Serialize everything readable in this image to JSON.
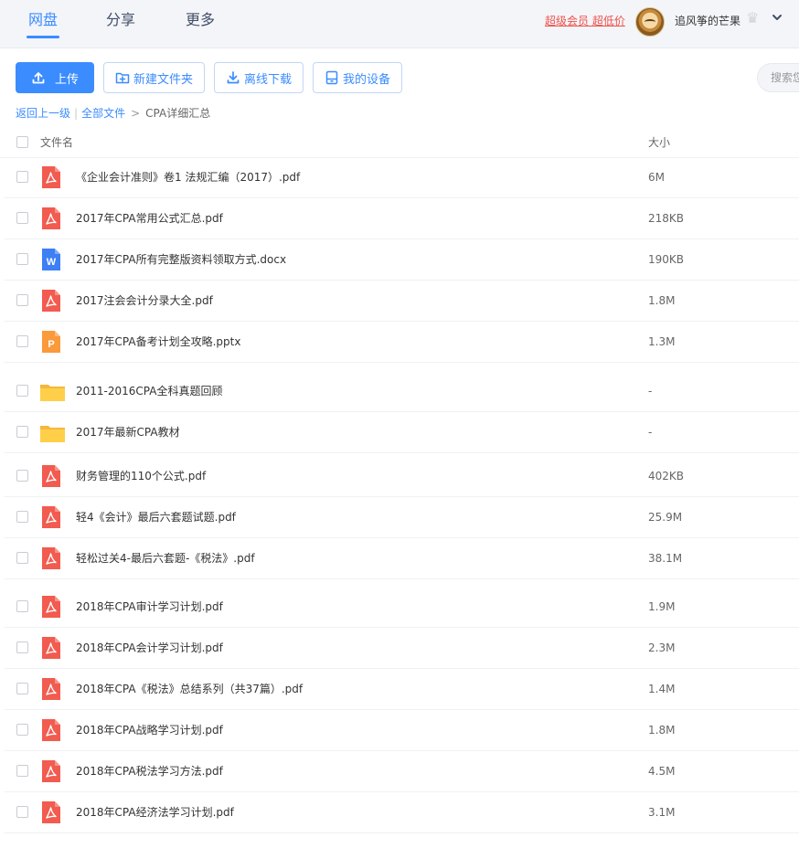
{
  "nav": {
    "tabs": [
      {
        "label": "网盘",
        "active": true
      },
      {
        "label": "分享",
        "active": false
      },
      {
        "label": "更多",
        "active": false
      }
    ],
    "vip_link": "超级会员 超低价",
    "username": "追风筝的芒果"
  },
  "toolbar": {
    "upload_label": "上传",
    "new_folder_label": "新建文件夹",
    "offline_download_label": "离线下载",
    "my_devices_label": "我的设备",
    "search_placeholder": "搜索您"
  },
  "breadcrumb": {
    "back": "返回上一级",
    "all_files": "全部文件",
    "current": "CPA详细汇总"
  },
  "columns": {
    "name": "文件名",
    "size": "大小"
  },
  "files": [
    {
      "name": "《企业会计准则》卷1 法规汇编（2017）.pdf",
      "size": "6M",
      "type": "pdf"
    },
    {
      "name": "2017年CPA常用公式汇总.pdf",
      "size": "218KB",
      "type": "pdf"
    },
    {
      "name": "2017年CPA所有完整版资料领取方式.docx",
      "size": "190KB",
      "type": "docx"
    },
    {
      "name": "2017注会会计分录大全.pdf",
      "size": "1.8M",
      "type": "pdf"
    },
    {
      "name": "2017年CPA备考计划全攻略.pptx",
      "size": "1.3M",
      "type": "pptx"
    },
    {
      "name": "2011-2016CPA全科真题回顾",
      "size": "-",
      "type": "folder"
    },
    {
      "name": "2017年最新CPA教材",
      "size": "-",
      "type": "folder"
    },
    {
      "name": "财务管理的110个公式.pdf",
      "size": "402KB",
      "type": "pdf"
    },
    {
      "name": "轻4《会计》最后六套题试题.pdf",
      "size": "25.9M",
      "type": "pdf"
    },
    {
      "name": "轻松过关4-最后六套题-《税法》.pdf",
      "size": "38.1M",
      "type": "pdf"
    },
    {
      "name": "2018年CPA审计学习计划.pdf",
      "size": "1.9M",
      "type": "pdf"
    },
    {
      "name": "2018年CPA会计学习计划.pdf",
      "size": "2.3M",
      "type": "pdf"
    },
    {
      "name": "2018年CPA《税法》总结系列（共37篇）.pdf",
      "size": "1.4M",
      "type": "pdf"
    },
    {
      "name": "2018年CPA战略学习计划.pdf",
      "size": "1.8M",
      "type": "pdf"
    },
    {
      "name": "2018年CPA税法学习方法.pdf",
      "size": "4.5M",
      "type": "pdf"
    },
    {
      "name": "2018年CPA经济法学习计划.pdf",
      "size": "3.1M",
      "type": "pdf"
    }
  ],
  "colors": {
    "accent": "#3b8cff",
    "pdf": "#f25b4f",
    "docx": "#3d7ff5",
    "pptx": "#fa9a3b",
    "folder": "#ffcf4a",
    "vip": "#f0504a"
  },
  "icons": {
    "pdf": "pdf-file-icon",
    "docx": "word-file-icon",
    "pptx": "powerpoint-file-icon",
    "folder": "folder-icon"
  }
}
